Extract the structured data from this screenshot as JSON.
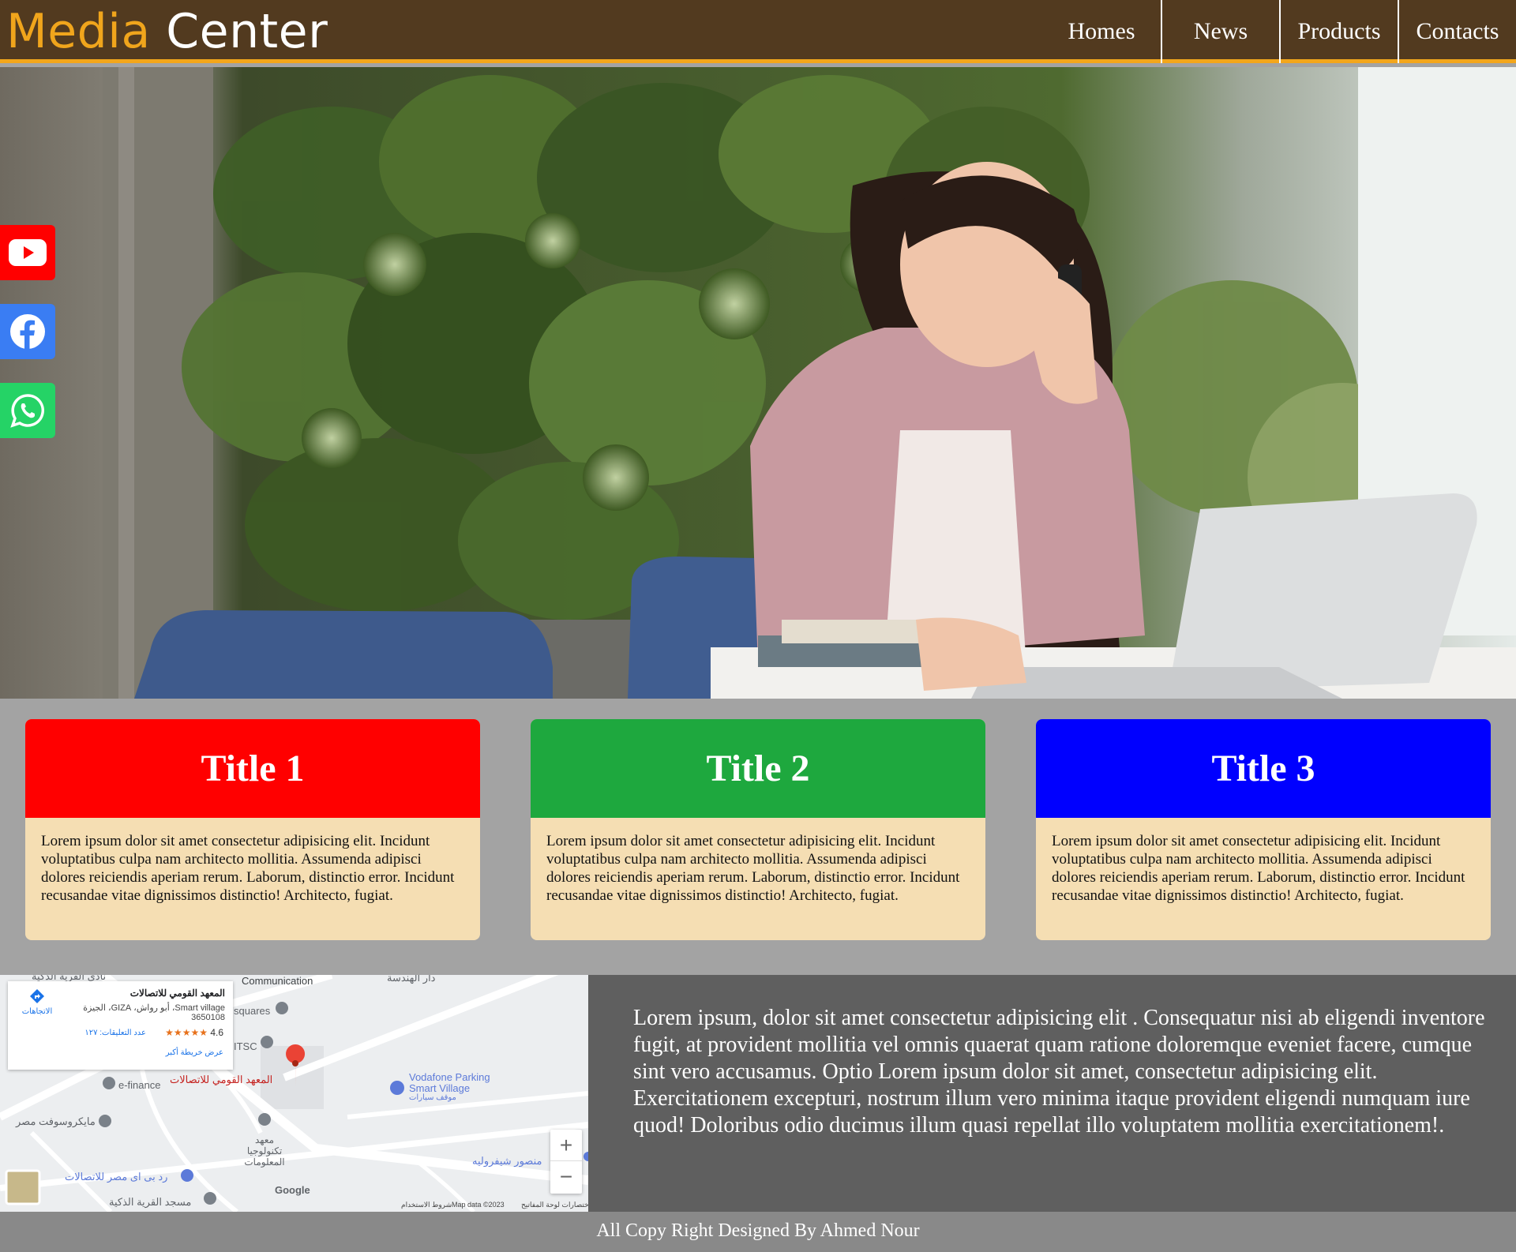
{
  "header": {
    "logo_part1": "Media",
    "logo_part2": " Center",
    "nav": [
      "Homes",
      "News",
      "Products",
      "Contacts"
    ]
  },
  "social": {
    "icons": [
      "youtube-icon",
      "facebook-icon",
      "whatsapp-icon"
    ]
  },
  "cards": [
    {
      "title": "Title 1",
      "text": "Lorem ipsum dolor sit amet consectetur adipisicing elit. Incidunt voluptatibus culpa nam architecto mollitia. Assumenda adipisci dolores reiciendis aperiam rerum. Laborum, distinctio error. Incidunt recusandae vitae dignissimos distinctio! Architecto, fugiat."
    },
    {
      "title": "Title 2",
      "text": "Lorem ipsum dolor sit amet consectetur adipisicing elit. Incidunt voluptatibus culpa nam architecto mollitia. Assumenda adipisci dolores reiciendis aperiam rerum. Laborum, distinctio error. Incidunt recusandae vitae dignissimos distinctio! Architecto, fugiat."
    },
    {
      "title": "Title 3",
      "text": "Lorem ipsum dolor sit amet consectetur adipisicing elit. Incidunt voluptatibus culpa nam architecto mollitia. Assumenda adipisci dolores reiciendis aperiam rerum. Laborum, distinctio error. Incidunt recusandae vitae dignissimos distinctio! Architecto, fugiat."
    }
  ],
  "map": {
    "place_name": "المعهد القومي للاتصالات",
    "address": "Smart village، أبو رواش، GIZA، الجيزة 3650108",
    "rating": "4.6",
    "stars": "★★★★★",
    "reviews": "عدد التعليقات: ١٢٧",
    "directions": "الاتجاهات",
    "larger_map": "عرض خريطة أكبر",
    "labels": {
      "communication": "Communication",
      "squares": "squares",
      "itsc": "ITSC",
      "efinance": "e-finance",
      "nti": "المعهد القومي للاتصالات",
      "vodafone_parking": "Vodafone Parking",
      "smart_village": "Smart Village",
      "parking_ar": "موقف سيارات",
      "microsoft": "مايكروسوفت مصر",
      "iti": "معهد تكنولوجيا المعلومات",
      "mansour": "منصور شيفروليه",
      "redbit": "رد بى اى مصر للاتصالات",
      "mosque": "مسجد القرية الذكية",
      "engineering": "دار الهندسة",
      "club": "نادي القرية الذكية",
      "google": "Google",
      "map_data": "Map data ©2023",
      "terms": "شروط الاستخدام",
      "shortcuts": "اختصارات لوحة المفاتيح"
    },
    "zoom_in": "+",
    "zoom_out": "−"
  },
  "about": {
    "text": "Lorem ipsum, dolor sit amet consectetur adipisicing elit . Consequatur nisi ab eligendi inventore fugit, at provident mollitia vel omnis quaerat quam ratione doloremque eveniet facere, cumque sint vero accusamus. Optio Lorem ipsum dolor sit amet, consectetur adipisicing elit. Exercitationem excepturi, nostrum illum vero minima itaque provident eligendi numquam iure quod! Doloribus odio ducimus illum quasi repellat illo voluptatem mollitia exercitationem!."
  },
  "footer": {
    "text": "All Copy Right Designed By Ahmed Nour"
  },
  "colors": {
    "header_bg": "#523a1f",
    "accent": "#f3a61b",
    "card1": "#ff0000",
    "card2": "#1ea83e",
    "card3": "#0000ff",
    "card_body": "#f5deb3",
    "about_bg": "#5f5f5f",
    "footer_bg": "#898989"
  }
}
